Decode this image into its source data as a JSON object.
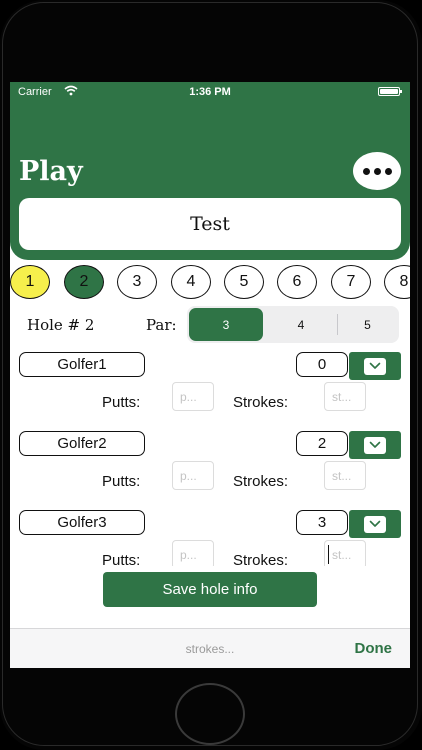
{
  "status_bar": {
    "carrier": "Carrier",
    "time": "1:36 PM"
  },
  "header": {
    "title": "Play",
    "course_name": "Test"
  },
  "holes": [
    {
      "label": "1",
      "state": "played"
    },
    {
      "label": "2",
      "state": "current"
    },
    {
      "label": "3",
      "state": "upcoming"
    },
    {
      "label": "4",
      "state": "upcoming"
    },
    {
      "label": "5",
      "state": "upcoming"
    },
    {
      "label": "6",
      "state": "upcoming"
    },
    {
      "label": "7",
      "state": "upcoming"
    },
    {
      "label": "8",
      "state": "upcoming"
    }
  ],
  "hole_info": {
    "hole_label": "Hole # 2",
    "par_label": "Par:",
    "par_options": [
      "3",
      "4",
      "5"
    ],
    "par_selected": "3"
  },
  "golfers": [
    {
      "name": "Golfer1",
      "score": "0",
      "putts_label": "Putts:",
      "putts_placeholder": "p...",
      "strokes_label": "Strokes:",
      "strokes_placeholder": "st..."
    },
    {
      "name": "Golfer2",
      "score": "2",
      "putts_label": "Putts:",
      "putts_placeholder": "p...",
      "strokes_label": "Strokes:",
      "strokes_placeholder": "st..."
    },
    {
      "name": "Golfer3",
      "score": "3",
      "putts_label": "Putts:",
      "putts_placeholder": "p...",
      "strokes_label": "Strokes:",
      "strokes_placeholder": "st..."
    }
  ],
  "save_button": "Save hole info",
  "keyboard_accessory": {
    "placeholder": "strokes...",
    "done_label": "Done"
  },
  "colors": {
    "accent": "#2f7446",
    "played_hole": "#f6ef4c",
    "background": "#ffffff"
  },
  "icons": {
    "more": "ellipsis-icon",
    "dropdown": "chevron-down-icon",
    "wifi": "wifi-icon",
    "battery": "battery-icon"
  }
}
